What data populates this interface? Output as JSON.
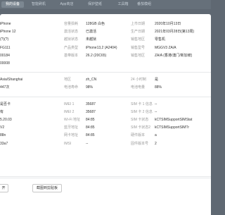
{
  "tabs": [
    "我的设备",
    "智能刷机",
    "App商店",
    "保护壁纸",
    "工具箱",
    "番茄模组"
  ],
  "rows": [
    {
      "left": "iPhone",
      "mid_label": "容量损耗",
      "mid_value": "128GB 白色",
      "right_label": "上市日期",
      "right_value": "2020年10月13日"
    },
    {
      "left": "iPhone 12",
      "mid_label": "激活状态",
      "mid_value": "已激活",
      "right_label": "生产日期",
      "right_value": "2021年03月28日(第13周)"
    },
    {
      "left": "(?)(?)",
      "mid_label": "越狱状态",
      "mid_value": "未越狱",
      "right_label": "销售地区",
      "right_value": "零售机"
    },
    {
      "left": "FG111",
      "mid_label": "产品类型",
      "mid_value": "iPhone13,2 (A2404)",
      "right_label": "销售型号",
      "right_value": "MGGV3 ZA/A"
    },
    {
      "left": "00184",
      "mid_label": "基带版本",
      "mid_value": "26.2 (20C65)",
      "right_label": "销售地区",
      "right_value": "ZA/A (香港/澳门/新加坡)"
    },
    {
      "left": "00008",
      "mid_label": "",
      "mid_value": "",
      "right_label": "",
      "right_value": ""
    },
    {
      "left": "Asia/Shanghai",
      "mid_label": "地区",
      "mid_value": "zh_CN",
      "right_label": "24 小时制",
      "right_value": "是"
    },
    {
      "left": "447次",
      "mid_label": "电池寿命",
      "mid_value": "98%",
      "right_label": "电池电量",
      "right_value": "88%"
    },
    {
      "left": "是否卡",
      "mid_label": "IMEI 1",
      "mid_value": "35687",
      "right_label": "SIM 卡 1 信息",
      "right_value": "--"
    },
    {
      "left": "有",
      "mid_label": "IMEI 2",
      "mid_value": "35687",
      "right_label": "SIM 卡 2 信息",
      "right_value": "--"
    },
    {
      "left": "5.20.03",
      "mid_label": "Wi-Fi 地址",
      "mid_value": "84:85",
      "right_label": "SIM 卡状态",
      "right_value": "kCTSIMSupportSIMStat"
    },
    {
      "left": "V2",
      "mid_label": "蓝牙地址",
      "mid_value": "84:85",
      "right_label": "SIM 卡状态2",
      "right_value": "kCTSIMSupportSIMTr"
    },
    {
      "left": "88n",
      "mid_label": "网卡地址",
      "mid_value": "84:85",
      "right_label": "硬件版本",
      "right_value": "a"
    },
    {
      "left": "33a7",
      "mid_label": "IMSI",
      "mid_value": "--",
      "right_label": "固件版本号",
      "right_value": "2"
    }
  ],
  "footer": {
    "left_button": "开",
    "right_button": "截图到剪贴板"
  }
}
